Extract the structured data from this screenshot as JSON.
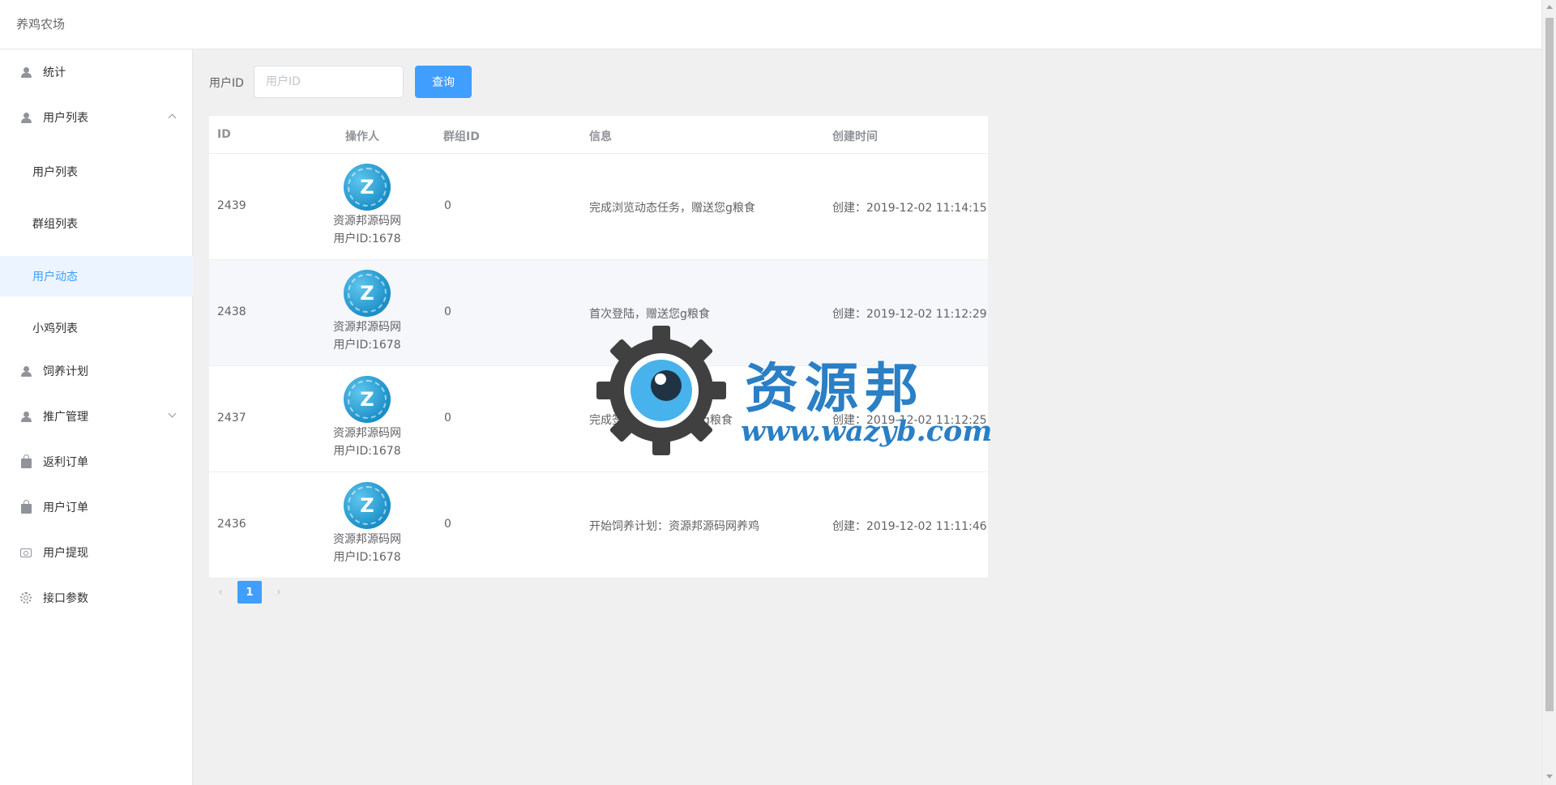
{
  "app": {
    "title": "养鸡农场"
  },
  "sidebar": {
    "items": [
      {
        "label": "统计",
        "icon": "person-icon"
      },
      {
        "label": "用户列表",
        "icon": "person-icon",
        "expanded": true,
        "children": [
          {
            "label": "用户列表"
          },
          {
            "label": "群组列表"
          },
          {
            "label": "用户动态",
            "active": true
          },
          {
            "label": "小鸡列表"
          }
        ]
      },
      {
        "label": "饲养计划",
        "icon": "person-icon"
      },
      {
        "label": "推广管理",
        "icon": "person-icon",
        "expanded": false
      },
      {
        "label": "返利订单",
        "icon": "bag-icon"
      },
      {
        "label": "用户订单",
        "icon": "bag-icon"
      },
      {
        "label": "用户提现",
        "icon": "wallet-icon"
      },
      {
        "label": "接口参数",
        "icon": "gear-icon"
      }
    ]
  },
  "search": {
    "label": "用户ID",
    "placeholder": "用户ID",
    "value": "",
    "button_label": "查询"
  },
  "table": {
    "columns": [
      "ID",
      "操作人",
      "群组ID",
      "信息",
      "创建时间"
    ],
    "rows": [
      {
        "id": "2439",
        "operator_name": "资源邦源码网",
        "operator_uid": "用户ID:1678",
        "group_id": "0",
        "info": "完成浏览动态任务，赠送您g粮食",
        "created": "创建：2019-12-02 11:14:15"
      },
      {
        "id": "2438",
        "operator_name": "资源邦源码网",
        "operator_uid": "用户ID:1678",
        "group_id": "0",
        "info": "首次登陆，赠送您g粮食",
        "created": "创建：2019-12-02 11:12:29"
      },
      {
        "id": "2437",
        "operator_name": "资源邦源码网",
        "operator_uid": "用户ID:1678",
        "group_id": "0",
        "info": "完成签到任务，赠送您g粮食",
        "created": "创建：2019-12-02 11:12:25"
      },
      {
        "id": "2436",
        "operator_name": "资源邦源码网",
        "operator_uid": "用户ID:1678",
        "group_id": "0",
        "info": "开始饲养计划：资源邦源码网养鸡",
        "created": "创建：2019-12-02 11:11:46"
      }
    ],
    "avatar_letter": "Z"
  },
  "pagination": {
    "prev": "‹",
    "current": "1",
    "next": "›"
  },
  "watermark": {
    "line1": "资源邦",
    "line2": "www.wazyb.com"
  },
  "colors": {
    "accent": "#409eff",
    "active_bg": "#ecf5ff",
    "watermark": "#2a7fc5"
  }
}
